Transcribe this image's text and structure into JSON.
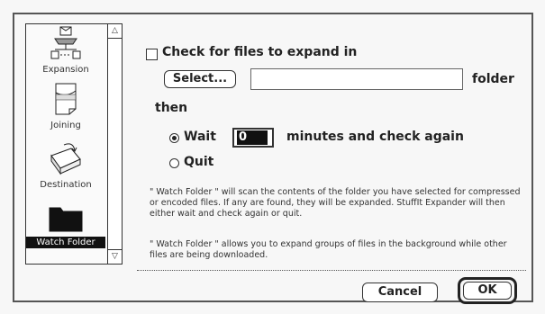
{
  "sidebar": {
    "items": [
      {
        "label": "Expansion",
        "icon": "expansion-icon",
        "selected": false
      },
      {
        "label": "Joining",
        "icon": "joining-icon",
        "selected": false
      },
      {
        "label": "Destination",
        "icon": "destination-icon",
        "selected": false
      },
      {
        "label": "Watch Folder",
        "icon": "folder-icon",
        "selected": true
      }
    ]
  },
  "main": {
    "check_label": "Check for files to expand in",
    "select_button": "Select...",
    "folder_path_value": "",
    "folder_suffix": "folder",
    "then_label": "then",
    "wait_label": "Wait",
    "minutes_value": "0",
    "minutes_suffix": "minutes and check again",
    "quit_label": "Quit",
    "description_1": "\" Watch Folder \" will scan the contents of the folder you have selected for compressed or encoded files. If any are found, they will be expanded. StuffIt Expander will then either wait and check again or quit.",
    "description_2": "\" Watch Folder \" allows you to expand groups of files in the background while other files are being downloaded."
  },
  "footer": {
    "cancel_label": "Cancel",
    "ok_label": "OK"
  }
}
